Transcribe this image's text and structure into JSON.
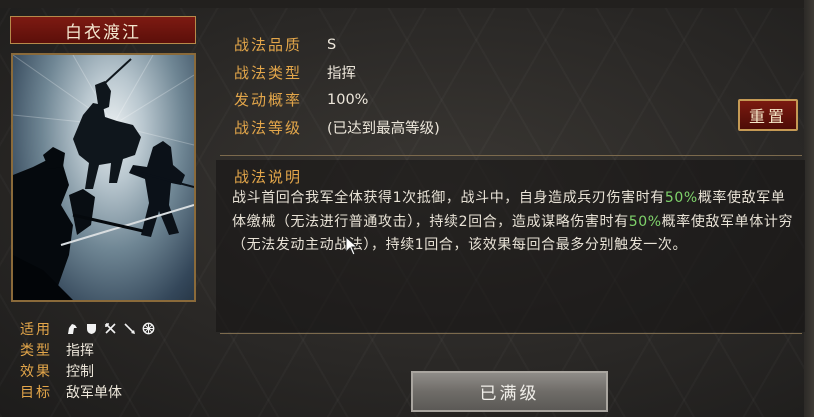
{
  "skill": {
    "name": "白衣渡江"
  },
  "stats": [
    {
      "label": "适用",
      "value": ""
    },
    {
      "label": "类型",
      "value": "指挥"
    },
    {
      "label": "效果",
      "value": "控制"
    },
    {
      "label": "目标",
      "value": "敌军单体"
    }
  ],
  "troop_icons": [
    "cavalry-icon",
    "shield-icon",
    "archer-icon",
    "spear-icon",
    "siege-wheel-icon"
  ],
  "attributes": [
    {
      "label": "战法品质",
      "value": "S"
    },
    {
      "label": "战法类型",
      "value": "指挥"
    },
    {
      "label": "发动概率",
      "value": "100%"
    },
    {
      "label": "战法等级",
      "value": "(已达到最高等级)"
    }
  ],
  "reset_label": "重置",
  "description": {
    "title": "战法说明",
    "parts": [
      {
        "t": "战斗首回合我军全体获得1次抵御，战斗中，自身造成兵刃伤害时有",
        "hl": false
      },
      {
        "t": "50%",
        "hl": true
      },
      {
        "t": "概率使敌军单体缴械（无法进行普通攻击），持续2回合，造成谋略伤害时有",
        "hl": false
      },
      {
        "t": "50%",
        "hl": true
      },
      {
        "t": "概率使敌军单体计穷（无法发动主动战法），持续1回合，该效果每回合最多分别触发一次。",
        "hl": false
      }
    ]
  },
  "maxed_label": "已满级",
  "colors": {
    "accent_gold": "#e3a64a",
    "highlight_green": "#7fd36b",
    "banner_red": "#7d1a12"
  }
}
